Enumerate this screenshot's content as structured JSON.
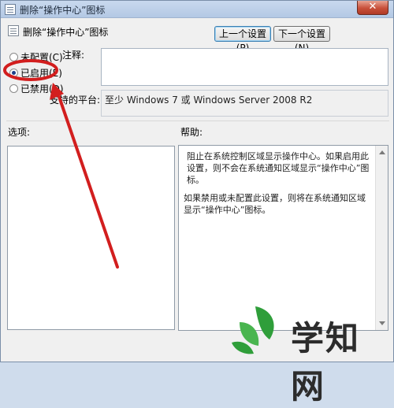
{
  "window": {
    "title": "删除“操作中心”图标",
    "close_glyph": "✕"
  },
  "header": {
    "policy_name": "删除“操作中心”图标",
    "prev_button": "上一个设置(P)",
    "next_button": "下一个设置(N)"
  },
  "state": {
    "options": [
      {
        "label": "未配置(C)",
        "selected": false
      },
      {
        "label": "已启用(E)",
        "selected": true
      },
      {
        "label": "已禁用(D)",
        "selected": false
      }
    ]
  },
  "comment": {
    "label": "注释:",
    "value": ""
  },
  "platform": {
    "label": "支持的平台:",
    "value": "至少 Windows 7 或 Windows Server 2008 R2"
  },
  "options_section": {
    "label": "选项:"
  },
  "help_section": {
    "label": "帮助:",
    "paragraphs": [
      "阻止在系统控制区域显示操作中心。如果启用此设置，则不会在系统通知区域显示“操作中心”图标。",
      "如果禁用或未配置此设置，则将在系统通知区域显示“操作中心”图标。"
    ]
  },
  "watermark": {
    "text": "学知网"
  },
  "colors": {
    "annotation_red": "#d21e1e",
    "watermark_green": "#2f9e3a"
  },
  "icons": {
    "window_icon": "policy-doc-icon",
    "header_icon": "policy-doc-icon"
  }
}
